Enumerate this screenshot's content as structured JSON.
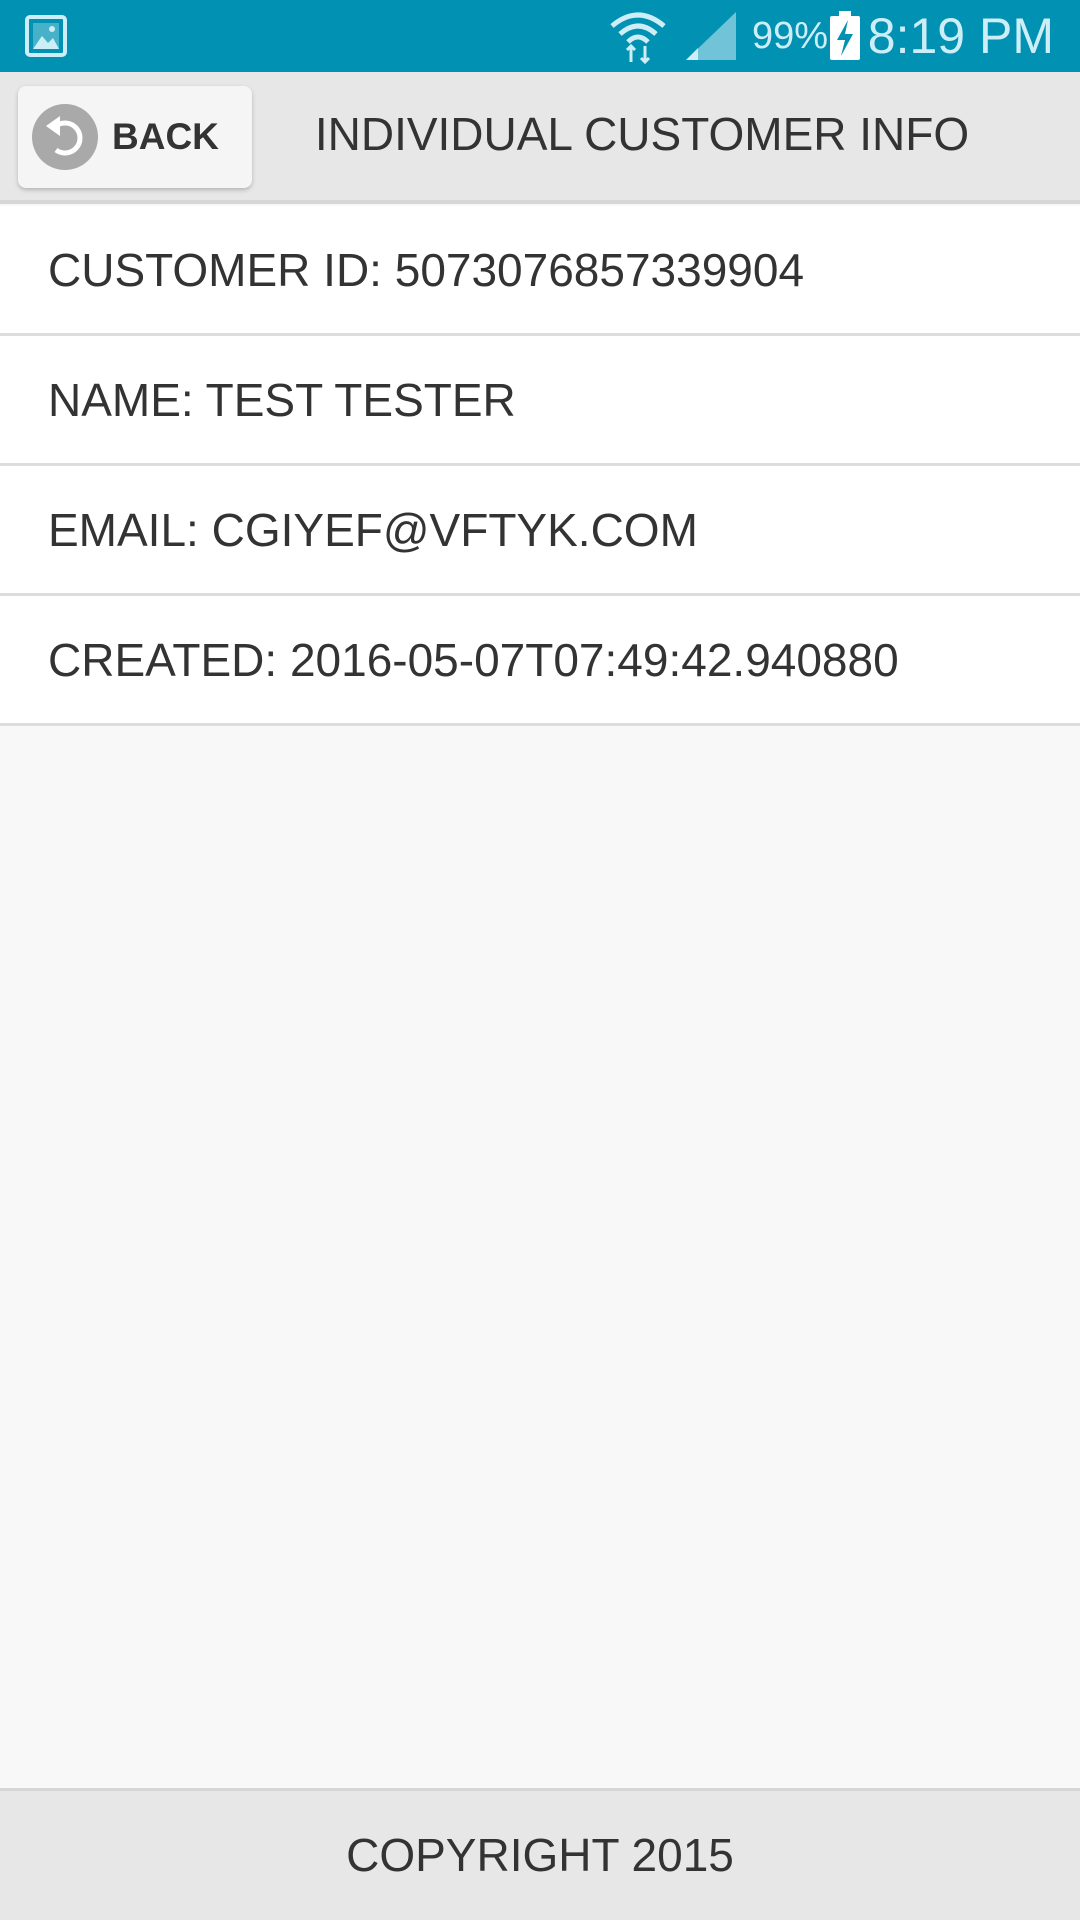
{
  "status_bar": {
    "battery_percent": "99%",
    "time": "8:19 PM",
    "icons": [
      "gallery-icon",
      "wifi-icon",
      "signal-icon",
      "battery-charging-icon"
    ],
    "background_color": "#0091b3"
  },
  "header": {
    "back_label": "BACK",
    "back_icon": "undo-arrow-icon",
    "title": "INDIVIDUAL CUSTOMER INFO"
  },
  "customer": {
    "id_text": "CUSTOMER ID: 5073076857339904",
    "name_text": "NAME: TEST TESTER",
    "email_text": "EMAIL: CGIYEF@VFTYK.COM",
    "created_text": "CREATED: 2016-05-07T07:49:42.940880"
  },
  "footer": {
    "copyright": "COPYRIGHT 2015"
  }
}
